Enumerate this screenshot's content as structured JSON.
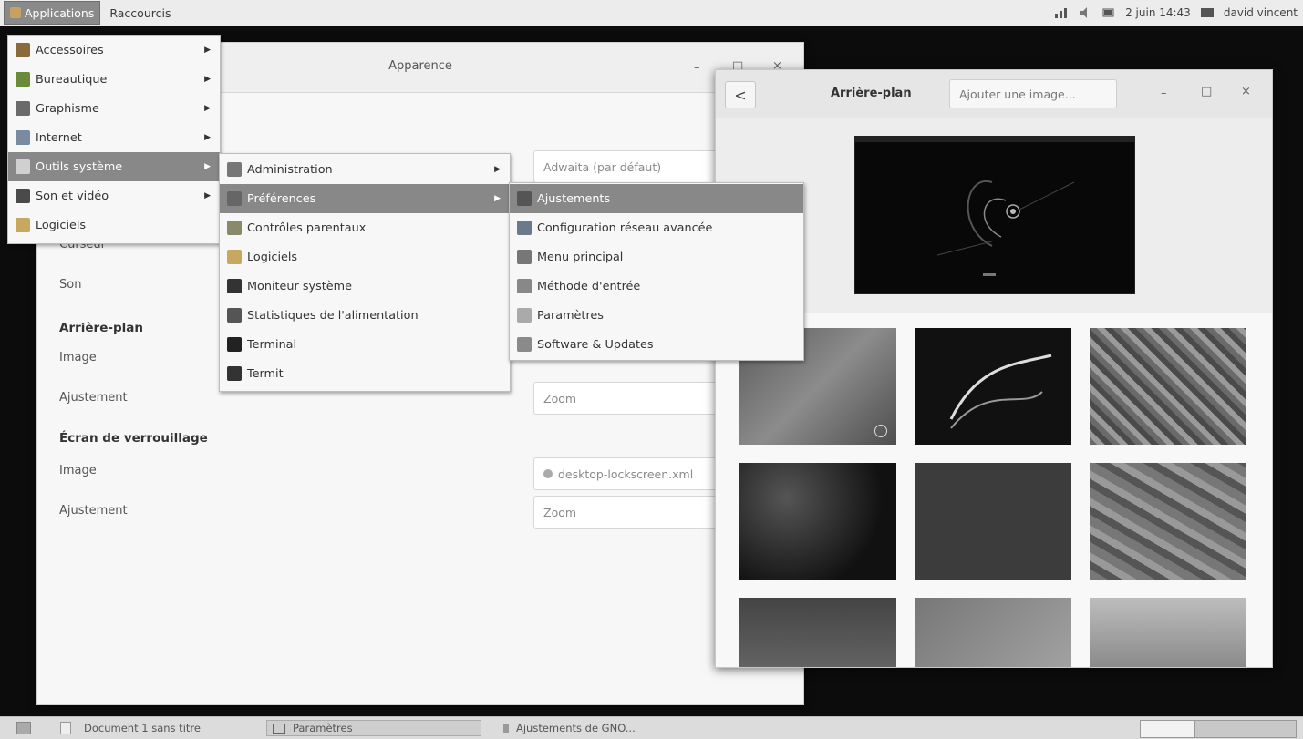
{
  "topbar": {
    "applications": "Applications",
    "shortcuts": "Raccourcis",
    "datetime": "2 juin 14:43",
    "user": "david vincent",
    "icons": [
      "network-icon",
      "volume-icon",
      "battery-icon",
      "user-icon"
    ]
  },
  "apparence": {
    "title": "Apparence",
    "theme_value": "Adwaita (par défaut)",
    "labels": {
      "cursor": "Curseur",
      "sound": "Son",
      "background_section": "Arrière-plan",
      "bg_image": "Image",
      "bg_adjust": "Ajustement",
      "lock_section": "Écran de verrouillage",
      "lock_image": "Image",
      "lock_adjust": "Ajustement"
    },
    "bg_adjust_value": "Zoom",
    "lock_image_value": "desktop-lockscreen.xml",
    "lock_adjust_value": "Zoom"
  },
  "background_dialog": {
    "title": "Arrière-plan",
    "add_image": "Ajouter une image...",
    "back": "<"
  },
  "menu_main": [
    {
      "label": "Accessoires",
      "icon": "accessories-icon",
      "submenu": true
    },
    {
      "label": "Bureautique",
      "icon": "office-icon",
      "submenu": true
    },
    {
      "label": "Graphisme",
      "icon": "graphics-icon",
      "submenu": true
    },
    {
      "label": "Internet",
      "icon": "internet-icon",
      "submenu": true
    },
    {
      "label": "Outils système",
      "icon": "system-tools-icon",
      "submenu": true,
      "selected": true
    },
    {
      "label": "Son et vidéo",
      "icon": "multimedia-icon",
      "submenu": true
    },
    {
      "label": "Logiciels",
      "icon": "software-icon",
      "submenu": false
    }
  ],
  "menu_system": [
    {
      "label": "Administration",
      "icon": "administration-icon",
      "submenu": true
    },
    {
      "label": "Préférences",
      "icon": "preferences-icon",
      "submenu": true,
      "selected": true
    },
    {
      "label": "Contrôles parentaux",
      "icon": "parental-controls-icon",
      "submenu": false
    },
    {
      "label": "Logiciels",
      "icon": "software-icon",
      "submenu": false
    },
    {
      "label": "Moniteur système",
      "icon": "system-monitor-icon",
      "submenu": false
    },
    {
      "label": "Statistiques de l'alimentation",
      "icon": "power-statistics-icon",
      "submenu": false
    },
    {
      "label": "Terminal",
      "icon": "terminal-icon",
      "submenu": false
    },
    {
      "label": "Termit",
      "icon": "termit-icon",
      "submenu": false
    }
  ],
  "menu_prefs": [
    {
      "label": "Ajustements",
      "icon": "tweaks-icon",
      "selected": true
    },
    {
      "label": "Configuration réseau avancée",
      "icon": "network-config-icon"
    },
    {
      "label": "Menu principal",
      "icon": "main-menu-icon"
    },
    {
      "label": "Méthode d'entrée",
      "icon": "input-method-icon"
    },
    {
      "label": "Paramètres",
      "icon": "settings-icon"
    },
    {
      "label": "Software & Updates",
      "icon": "software-updates-icon"
    }
  ],
  "taskbar": {
    "tasks": [
      "Document 1 sans titre",
      "Paramètres",
      "Ajustements de GNO..."
    ]
  },
  "colors": {
    "menu_selected": "#888888",
    "panel": "#ececec"
  }
}
